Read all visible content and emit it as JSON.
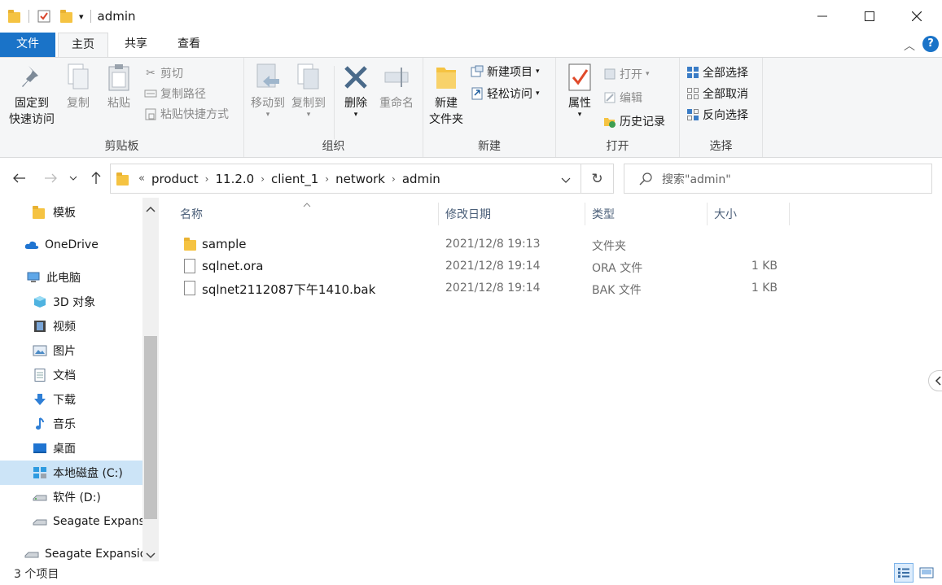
{
  "window": {
    "title": "admin"
  },
  "tabs": {
    "file": "文件",
    "home": "主页",
    "share": "共享",
    "view": "查看"
  },
  "ribbon": {
    "clipboard": {
      "pin_line1": "固定到",
      "pin_line2": "快速访问",
      "copy": "复制",
      "paste": "粘贴",
      "cut": "剪切",
      "copy_path": "复制路径",
      "paste_shortcut": "粘贴快捷方式",
      "label": "剪贴板"
    },
    "organize": {
      "move_to": "移动到",
      "copy_to": "复制到",
      "delete": "删除",
      "rename": "重命名",
      "label": "组织"
    },
    "new": {
      "new_folder_line1": "新建",
      "new_folder_line2": "文件夹",
      "new_item": "新建项目",
      "easy_access": "轻松访问",
      "label": "新建"
    },
    "open": {
      "properties": "属性",
      "open": "打开",
      "edit": "编辑",
      "history": "历史记录",
      "label": "打开"
    },
    "select": {
      "select_all": "全部选择",
      "select_none": "全部取消",
      "invert": "反向选择",
      "label": "选择"
    }
  },
  "address": {
    "crumbs": [
      "product",
      "11.2.0",
      "client_1",
      "network",
      "admin"
    ],
    "overflow": "«"
  },
  "search": {
    "placeholder": "搜索\"admin\""
  },
  "nav": {
    "items": [
      {
        "label": "模板",
        "icon": "folder-icon"
      },
      {
        "label": "OneDrive",
        "icon": "cloud-icon"
      },
      {
        "label": "此电脑",
        "icon": "computer-icon"
      },
      {
        "label": "3D 对象",
        "icon": "cube-icon"
      },
      {
        "label": "视频",
        "icon": "video-icon"
      },
      {
        "label": "图片",
        "icon": "picture-icon"
      },
      {
        "label": "文档",
        "icon": "document-icon"
      },
      {
        "label": "下载",
        "icon": "download-icon"
      },
      {
        "label": "音乐",
        "icon": "music-icon"
      },
      {
        "label": "桌面",
        "icon": "desktop-icon"
      },
      {
        "label": "本地磁盘 (C:)",
        "icon": "drive-c-icon"
      },
      {
        "label": "软件 (D:)",
        "icon": "drive-icon"
      },
      {
        "label": "Seagate Expansion",
        "icon": "drive-icon"
      },
      {
        "label": "Seagate Expansion",
        "icon": "drive-icon"
      }
    ]
  },
  "columns": {
    "name": "名称",
    "date": "修改日期",
    "type": "类型",
    "size": "大小"
  },
  "files": [
    {
      "name": "sample",
      "date": "2021/12/8 19:13",
      "type": "文件夹",
      "size": ""
    },
    {
      "name": "sqlnet.ora",
      "date": "2021/12/8 19:14",
      "type": "ORA 文件",
      "size": "1 KB"
    },
    {
      "name": "sqlnet2112087下午1410.bak",
      "date": "2021/12/8 19:14",
      "type": "BAK 文件",
      "size": "1 KB"
    }
  ],
  "status": {
    "count": "3 个项目"
  },
  "colors": {
    "accent": "#1a73c8",
    "selection": "#cce4f7",
    "folder": "#f5c342"
  }
}
